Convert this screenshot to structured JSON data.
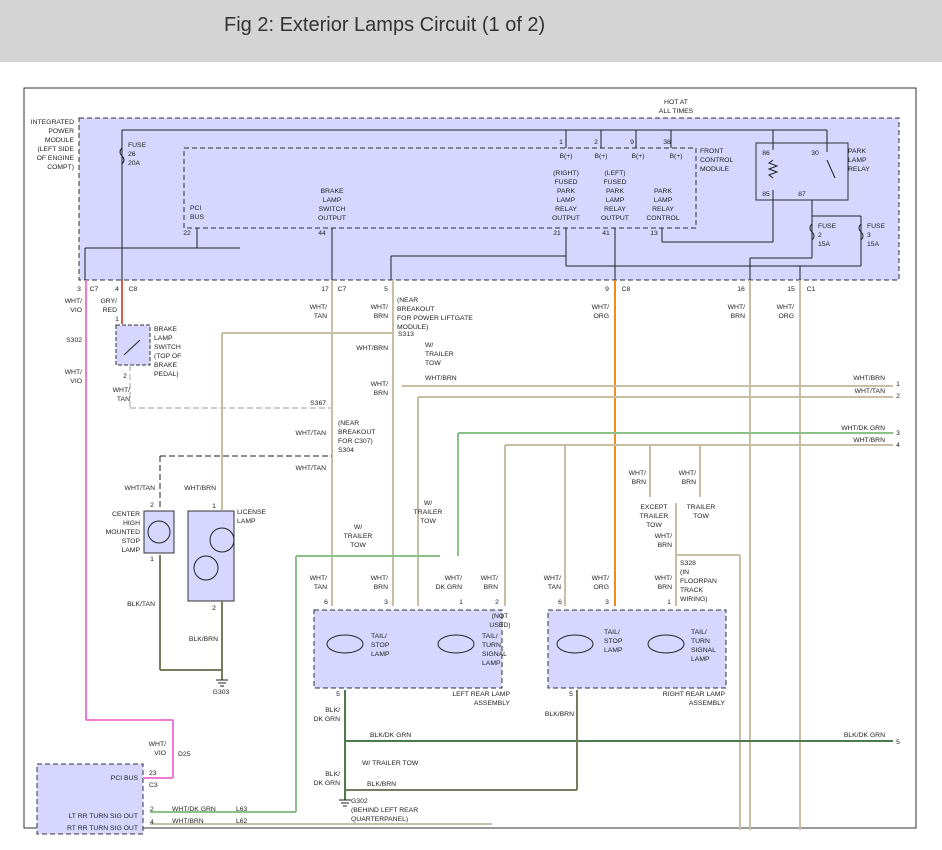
{
  "figure": {
    "title": "Fig 2: Exterior Lamps Circuit (1 of 2)"
  },
  "colors": {
    "module_fill": "#d6d6ff",
    "wire_default": "#c8bea4",
    "wire_gray": "#cfcfcf",
    "wire_orange": "#f08c1e",
    "wire_green": "#8bc08b",
    "wire_pink": "#f07ad2",
    "wire_olive": "#7a7a5e",
    "wire_dkgreen": "#4d7a4d",
    "wire_red": "#d06050"
  },
  "labels": [
    {
      "name": "ipm-label",
      "lines": [
        "INTEGRATED",
        "POWER",
        "MODULE",
        "(LEFT SIDE",
        "OF ENGINE",
        "COMPT)"
      ]
    },
    {
      "name": "hot-at-all-times",
      "lines": [
        "HOT AT",
        "ALL TIMES"
      ]
    },
    {
      "name": "fuse-26",
      "lines": [
        "FUSE",
        "26",
        "20A"
      ]
    },
    {
      "name": "fcm-label",
      "lines": [
        "FRONT",
        "CONTROL",
        "MODULE"
      ]
    },
    {
      "name": "park-lamp-relay",
      "lines": [
        "PARK",
        "LAMP",
        "RELAY"
      ]
    },
    {
      "name": "fuse-2",
      "lines": [
        "FUSE",
        "2",
        "15A"
      ]
    },
    {
      "name": "fuse-3",
      "lines": [
        "FUSE",
        "3",
        "15A"
      ]
    },
    {
      "name": "pci-bus-fcm",
      "lines": [
        "PCI",
        "BUS"
      ]
    },
    {
      "name": "brake-lamp-switch-output",
      "lines": [
        "BRAKE",
        "LAMP",
        "SWITCH",
        "OUTPUT"
      ]
    },
    {
      "name": "right-fused-park",
      "lines": [
        "(RIGHT)",
        "FUSED",
        "PARK",
        "LAMP",
        "RELAY",
        "OUTPUT"
      ]
    },
    {
      "name": "left-fused-park",
      "lines": [
        "(LEFT)",
        "FUSED",
        "PARK",
        "LAMP",
        "RELAY",
        "OUTPUT"
      ]
    },
    {
      "name": "park-relay-control",
      "lines": [
        "PARK",
        "LAMP",
        "RELAY",
        "CONTROL"
      ]
    },
    {
      "name": "b-plus-1",
      "lines": [
        "B(+)"
      ]
    },
    {
      "name": "b-plus-2",
      "lines": [
        "B(+)"
      ]
    },
    {
      "name": "b-plus-3",
      "lines": [
        "B(+)"
      ]
    },
    {
      "name": "b-plus-4",
      "lines": [
        "B(+)"
      ]
    },
    {
      "name": "relay-86",
      "lines": [
        "86"
      ]
    },
    {
      "name": "relay-30",
      "lines": [
        "30"
      ]
    },
    {
      "name": "relay-85",
      "lines": [
        "85"
      ]
    },
    {
      "name": "relay-87",
      "lines": [
        "87"
      ]
    },
    {
      "name": "pin-1",
      "lines": [
        "1"
      ]
    },
    {
      "name": "pin-2",
      "lines": [
        "2"
      ]
    },
    {
      "name": "pin-9",
      "lines": [
        "9"
      ]
    },
    {
      "name": "pin-38",
      "lines": [
        "38"
      ]
    },
    {
      "name": "pin-22",
      "lines": [
        "22"
      ]
    },
    {
      "name": "pin-44",
      "lines": [
        "44"
      ]
    },
    {
      "name": "pin-21",
      "lines": [
        "21"
      ]
    },
    {
      "name": "pin-41",
      "lines": [
        "41"
      ]
    },
    {
      "name": "pin-13",
      "lines": [
        "13"
      ]
    },
    {
      "name": "conn-3",
      "lines": [
        "3"
      ]
    },
    {
      "name": "conn-c7a",
      "lines": [
        "C7"
      ]
    },
    {
      "name": "conn-4",
      "lines": [
        "4"
      ]
    },
    {
      "name": "conn-c8a",
      "lines": [
        "C8"
      ]
    },
    {
      "name": "conn-17",
      "lines": [
        "17"
      ]
    },
    {
      "name": "conn-c7b",
      "lines": [
        "C7"
      ]
    },
    {
      "name": "conn-5",
      "lines": [
        "5"
      ]
    },
    {
      "name": "conn-9",
      "lines": [
        "9"
      ]
    },
    {
      "name": "conn-c8b",
      "lines": [
        "C8"
      ]
    },
    {
      "name": "conn-16",
      "lines": [
        "16"
      ]
    },
    {
      "name": "conn-15",
      "lines": [
        "15"
      ]
    },
    {
      "name": "conn-c1",
      "lines": [
        "C1"
      ]
    },
    {
      "name": "wire-wht-vio",
      "lines": [
        "WHT/",
        "VIO"
      ]
    },
    {
      "name": "wire-gry-red",
      "lines": [
        "GRY/",
        "RED"
      ]
    },
    {
      "name": "wire-wht-tan-1",
      "lines": [
        "WHT/",
        "TAN"
      ]
    },
    {
      "name": "wire-wht-brn-1",
      "lines": [
        "WHT/",
        "BRN"
      ]
    },
    {
      "name": "near-breakout-liftgate",
      "lines": [
        "(NEAR",
        "BREAKOUT",
        "FOR POWER LIFTGATE",
        "MODULE)"
      ]
    },
    {
      "name": "wire-wht-org-1",
      "lines": [
        "WHT/",
        "ORG"
      ]
    },
    {
      "name": "wire-wht-brn-2",
      "lines": [
        "WHT/",
        "BRN"
      ]
    },
    {
      "name": "wire-wht-org-2",
      "lines": [
        "WHT/",
        "ORG"
      ]
    },
    {
      "name": "s302",
      "lines": [
        "S302"
      ]
    },
    {
      "name": "wire-wht-vio-2",
      "lines": [
        "WHT/",
        "VIO"
      ]
    },
    {
      "name": "brake-lamp-switch",
      "lines": [
        "BRAKE",
        "LAMP",
        "SWITCH",
        "(TOP OF",
        "BRAKE",
        "PEDAL)"
      ]
    },
    {
      "name": "bls-pin-1",
      "lines": [
        "1"
      ]
    },
    {
      "name": "bls-pin-2",
      "lines": [
        "2"
      ]
    },
    {
      "name": "wire-wht-tan-2",
      "lines": [
        "WHT/",
        "TAN"
      ]
    },
    {
      "name": "s313",
      "lines": [
        "S313"
      ]
    },
    {
      "name": "wire-wht-brn-3",
      "lines": [
        "WHT/BRN"
      ]
    },
    {
      "name": "w-trailer-tow-1",
      "lines": [
        "W/",
        "TRAILER",
        "TOW"
      ]
    },
    {
      "name": "wire-wht-brn-4",
      "lines": [
        "WHT/BRN"
      ]
    },
    {
      "name": "wire-wht-brn-5",
      "lines": [
        "WHT/",
        "BRN"
      ]
    },
    {
      "name": "out-wht-brn-1",
      "lines": [
        "WHT/BRN"
      ]
    },
    {
      "name": "out-pin-1",
      "lines": [
        "1"
      ]
    },
    {
      "name": "out-wht-tan-2",
      "lines": [
        "WHT/TAN"
      ]
    },
    {
      "name": "out-pin-2",
      "lines": [
        "2"
      ]
    },
    {
      "name": "s367",
      "lines": [
        "S367"
      ]
    },
    {
      "name": "near-breakout-c307",
      "lines": [
        "(NEAR",
        "BREAKOUT",
        "FOR C307)"
      ]
    },
    {
      "name": "wire-wht-tan-3",
      "lines": [
        "WHT/TAN"
      ]
    },
    {
      "name": "s304",
      "lines": [
        "S304"
      ]
    },
    {
      "name": "out-wht-dkgrn-3",
      "lines": [
        "WHT/DK GRN"
      ]
    },
    {
      "name": "out-pin-3",
      "lines": [
        "3"
      ]
    },
    {
      "name": "out-wht-brn-4",
      "lines": [
        "WHT/BRN"
      ]
    },
    {
      "name": "out-pin-4",
      "lines": [
        "4"
      ]
    },
    {
      "name": "wire-wht-tan-4",
      "lines": [
        "WHT/TAN"
      ]
    },
    {
      "name": "wire-wht-tan-5",
      "lines": [
        "WHT/TAN"
      ]
    },
    {
      "name": "wire-wht-brn-6",
      "lines": [
        "WHT/BRN"
      ]
    },
    {
      "name": "wire-wht-brn-7",
      "lines": [
        "WHT/",
        "BRN"
      ]
    },
    {
      "name": "wire-wht-brn-8",
      "lines": [
        "WHT/",
        "BRN"
      ]
    },
    {
      "name": "except-trailer-tow",
      "lines": [
        "EXCEPT",
        "TRAILER",
        "TOW"
      ]
    },
    {
      "name": "trailer-tow",
      "lines": [
        "TRAILER",
        "TOW"
      ]
    },
    {
      "name": "w-trailer-tow-2",
      "lines": [
        "W/",
        "TRAILER",
        "TOW"
      ]
    },
    {
      "name": "w-trailer-tow-3",
      "lines": [
        "W/",
        "TRAILER",
        "TOW"
      ]
    },
    {
      "name": "wire-wht-brn-9",
      "lines": [
        "WHT/",
        "BRN"
      ]
    },
    {
      "name": "s328",
      "lines": [
        "S328",
        "(IN",
        "FLOORPAN",
        "TRACK",
        "WIRING)"
      ]
    },
    {
      "name": "chmsl",
      "lines": [
        "CENTER",
        "HIGH",
        "MOUNTED",
        "STOP",
        "LAMP"
      ]
    },
    {
      "name": "chmsl-pin-2",
      "lines": [
        "2"
      ]
    },
    {
      "name": "chmsl-pin-1",
      "lines": [
        "1"
      ]
    },
    {
      "name": "license-lamp",
      "lines": [
        "LICENSE",
        "LAMP"
      ]
    },
    {
      "name": "lic-pin-1",
      "lines": [
        "1"
      ]
    },
    {
      "name": "lic-pin-2",
      "lines": [
        "2"
      ]
    },
    {
      "name": "wire-blk-tan",
      "lines": [
        "BLK/TAN"
      ]
    },
    {
      "name": "wire-blk-brn-1",
      "lines": [
        "BLK/BRN"
      ]
    },
    {
      "name": "g303",
      "lines": [
        "G303"
      ]
    },
    {
      "name": "l-wht-tan",
      "lines": [
        "WHT/",
        "TAN"
      ]
    },
    {
      "name": "l-wht-brn",
      "lines": [
        "WHT/",
        "BRN"
      ]
    },
    {
      "name": "l-wht-dkgrn",
      "lines": [
        "WHT/",
        "DK GRN"
      ]
    },
    {
      "name": "l-wht-brn-2",
      "lines": [
        "WHT/",
        "BRN"
      ]
    },
    {
      "name": "l-pin-6",
      "lines": [
        "6"
      ]
    },
    {
      "name": "l-pin-3",
      "lines": [
        "3"
      ]
    },
    {
      "name": "l-pin-1",
      "lines": [
        "1"
      ]
    },
    {
      "name": "l-pin-2",
      "lines": [
        "2"
      ]
    },
    {
      "name": "l-not-used",
      "lines": [
        "(NOT",
        "USED)"
      ]
    },
    {
      "name": "l-tail-stop",
      "lines": [
        "TAIL/",
        "STOP",
        "LAMP"
      ]
    },
    {
      "name": "l-tail-turn",
      "lines": [
        "TAIL/",
        "TURN",
        "SIGNAL",
        "LAMP"
      ]
    },
    {
      "name": "l-pin-5",
      "lines": [
        "5"
      ]
    },
    {
      "name": "left-rear-lamp-assy",
      "lines": [
        "LEFT REAR LAMP",
        "ASSEMBLY"
      ]
    },
    {
      "name": "r-wht-tan",
      "lines": [
        "WHT/",
        "TAN"
      ]
    },
    {
      "name": "r-wht-org",
      "lines": [
        "WHT/",
        "ORG"
      ]
    },
    {
      "name": "r-wht-brn",
      "lines": [
        "WHT/",
        "BRN"
      ]
    },
    {
      "name": "r-pin-6",
      "lines": [
        "6"
      ]
    },
    {
      "name": "r-pin-3",
      "lines": [
        "3"
      ]
    },
    {
      "name": "r-pin-1",
      "lines": [
        "1"
      ]
    },
    {
      "name": "r-tail-stop",
      "lines": [
        "TAIL/",
        "STOP",
        "LAMP"
      ]
    },
    {
      "name": "r-tail-turn",
      "lines": [
        "TAIL/",
        "TURN",
        "SIGNAL",
        "LAMP"
      ]
    },
    {
      "name": "r-pin-5",
      "lines": [
        "5"
      ]
    },
    {
      "name": "right-rear-lamp-assy",
      "lines": [
        "RIGHT REAR LAMP",
        "ASSEMBLY"
      ]
    },
    {
      "name": "wire-blk-dkgrn-1",
      "lines": [
        "BLK/",
        "DK GRN"
      ]
    },
    {
      "name": "wire-blk-dkgrn-2",
      "lines": [
        "BLK/DK GRN"
      ]
    },
    {
      "name": "out-blk-dkgrn-5",
      "lines": [
        "BLK/DK GRN"
      ]
    },
    {
      "name": "out-pin-5",
      "lines": [
        "5"
      ]
    },
    {
      "name": "w-trailer-tow-4",
      "lines": [
        "W/ TRAILER TOW"
      ]
    },
    {
      "name": "wire-blk-dkgrn-3",
      "lines": [
        "BLK/",
        "DK GRN"
      ]
    },
    {
      "name": "wire-blk-brn-2",
      "lines": [
        "BLK/BRN"
      ]
    },
    {
      "name": "wire-blk-brn-3",
      "lines": [
        "BLK/BRN"
      ]
    },
    {
      "name": "g302",
      "lines": [
        "G302",
        "(BEHIND LEFT REAR",
        "QUARTERPANEL)"
      ]
    },
    {
      "name": "wire-wht-vio-3",
      "lines": [
        "WHT/",
        "VIO"
      ]
    },
    {
      "name": "d25",
      "lines": [
        "D25"
      ]
    },
    {
      "name": "pci-bus-2",
      "lines": [
        "PCI BUS"
      ]
    },
    {
      "name": "pci-pin-23",
      "lines": [
        "23"
      ]
    },
    {
      "name": "pci-c3",
      "lines": [
        "C3"
      ]
    },
    {
      "name": "lt-rr-turn",
      "lines": [
        "LT RR TURN SIG OUT"
      ]
    },
    {
      "name": "rt-rr-turn",
      "lines": [
        "RT RR TURN SIG OUT"
      ]
    },
    {
      "name": "turn-pin-2",
      "lines": [
        "2"
      ]
    },
    {
      "name": "turn-pin-4",
      "lines": [
        "4"
      ]
    },
    {
      "name": "wire-wht-dkgrn-b",
      "lines": [
        "WHT/DK GRN"
      ]
    },
    {
      "name": "wire-wht-brn-b",
      "lines": [
        "WHT/BRN"
      ]
    },
    {
      "name": "l63",
      "lines": [
        "L63"
      ]
    },
    {
      "name": "l62",
      "lines": [
        "L62"
      ]
    }
  ]
}
